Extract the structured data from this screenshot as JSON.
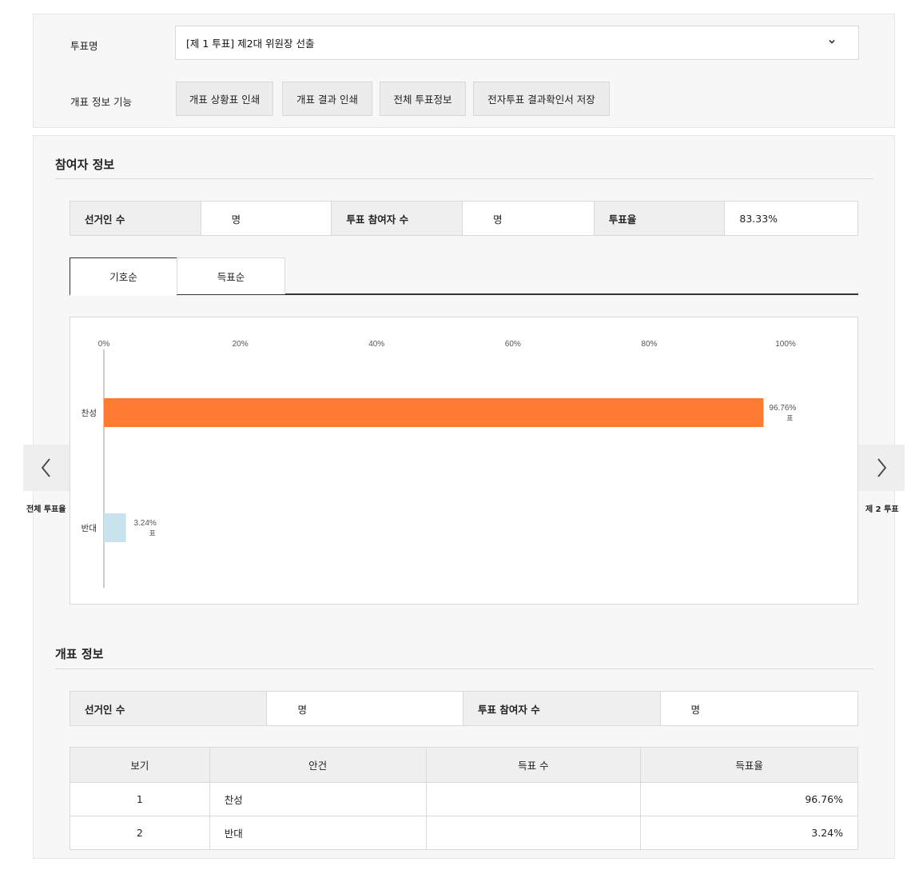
{
  "top": {
    "vote_name_label": "투표명",
    "vote_name_value": "[제 1 투표] 제2대 위원장 선출",
    "functions_label": "개표 정보 기능",
    "buttons": [
      "개표 상황표 인쇄",
      "개표 결과 인쇄",
      "전체 투표정보",
      "전자투표 결과확인서 저장"
    ]
  },
  "participants": {
    "title": "참여자 정보",
    "electors_label": "선거인 수",
    "electors_unit": "명",
    "voters_label": "투표 참여자 수",
    "voters_unit": "명",
    "turnout_label": "투표율",
    "turnout_value": "83.33%"
  },
  "tabs": [
    "기호순",
    "득표순"
  ],
  "nav": {
    "prev_label": "전체 투표율",
    "next_label": "제 2 투표"
  },
  "chart_data": {
    "type": "bar",
    "orientation": "horizontal",
    "categories": [
      "찬성",
      "반대"
    ],
    "values": [
      96.76,
      3.24
    ],
    "value_labels": [
      "96.76%",
      "3.24%"
    ],
    "unit_suffix": "표",
    "colors": [
      "#ff7a33",
      "#c8e3ee"
    ],
    "xlim": [
      0,
      100
    ],
    "x_ticks": [
      "0%",
      "20%",
      "40%",
      "60%",
      "80%",
      "100%"
    ]
  },
  "counting": {
    "title": "개표 정보",
    "electors_label": "선거인 수",
    "electors_unit": "명",
    "voters_label": "투표 참여자 수",
    "voters_unit": "명",
    "headers": [
      "보기",
      "안건",
      "득표 수",
      "득표율"
    ],
    "rows": [
      {
        "no": "1",
        "item": "찬성",
        "votes": "",
        "rate": "96.76%"
      },
      {
        "no": "2",
        "item": "반대",
        "votes": "",
        "rate": "3.24%"
      }
    ]
  }
}
